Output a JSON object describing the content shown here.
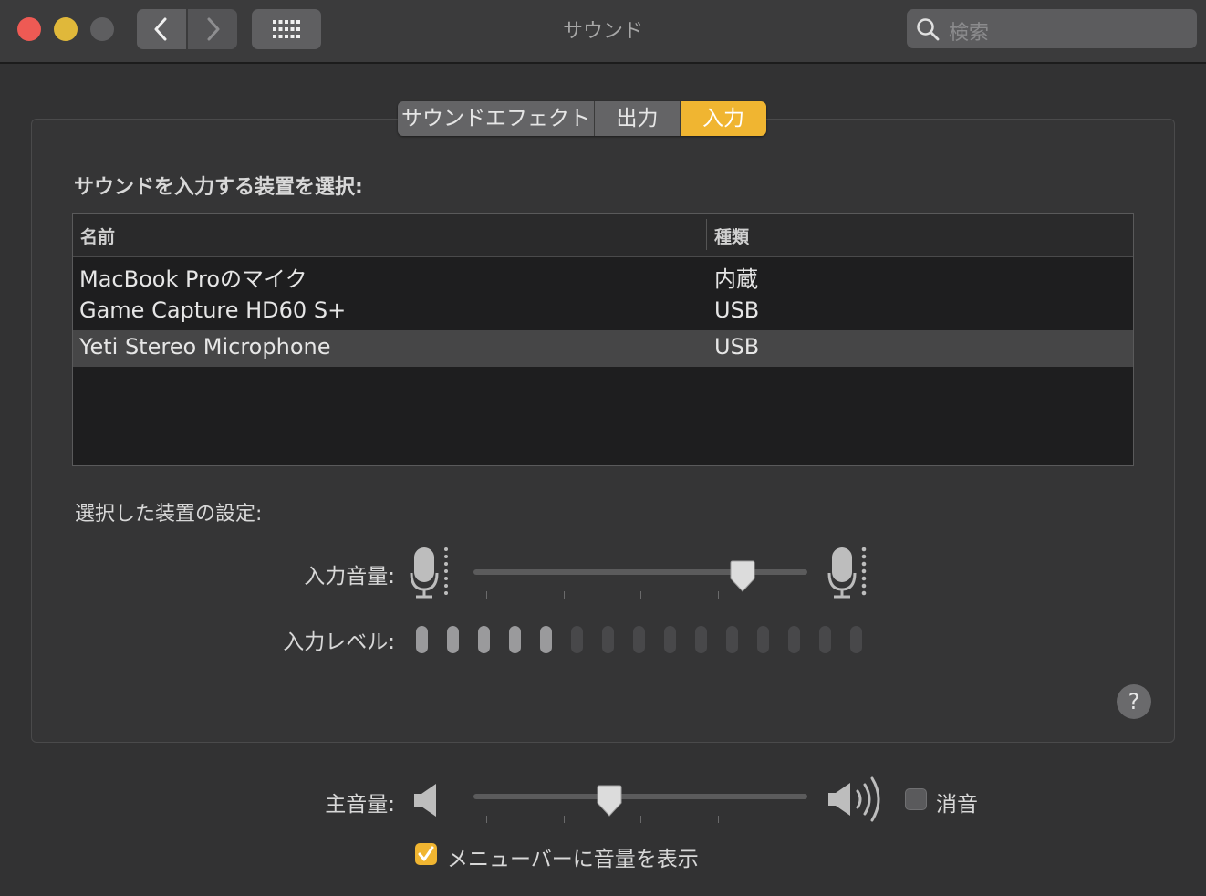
{
  "window": {
    "title": "サウンド"
  },
  "search": {
    "placeholder": "検索"
  },
  "tabs": [
    {
      "label": "サウンドエフェクト",
      "selected": false
    },
    {
      "label": "出力",
      "selected": false
    },
    {
      "label": "入力",
      "selected": true
    }
  ],
  "input": {
    "section_label": "サウンドを入力する装置を選択:",
    "columns": [
      "名前",
      "種類"
    ],
    "devices": [
      {
        "name": "MacBook Proのマイク",
        "type": "内蔵",
        "selected": false
      },
      {
        "name": "Game Capture HD60 S+",
        "type": "USB",
        "selected": false
      },
      {
        "name": "Yeti Stereo Microphone",
        "type": "USB",
        "selected": true
      }
    ],
    "settings_label": "選択した装置の設定:",
    "volume_label": "入力音量:",
    "volume_value": 0.83,
    "level_label": "入力レベル:",
    "level_total": 15,
    "level_active": 5
  },
  "main_volume": {
    "label": "主音量:",
    "value": 0.4,
    "mute_label": "消音",
    "mute_checked": false
  },
  "menubar_option": {
    "label": "メニューバーに音量を表示",
    "checked": true
  },
  "help": {
    "label": "?"
  },
  "colors": {
    "accent": "#f0b531",
    "background": "#323233"
  }
}
